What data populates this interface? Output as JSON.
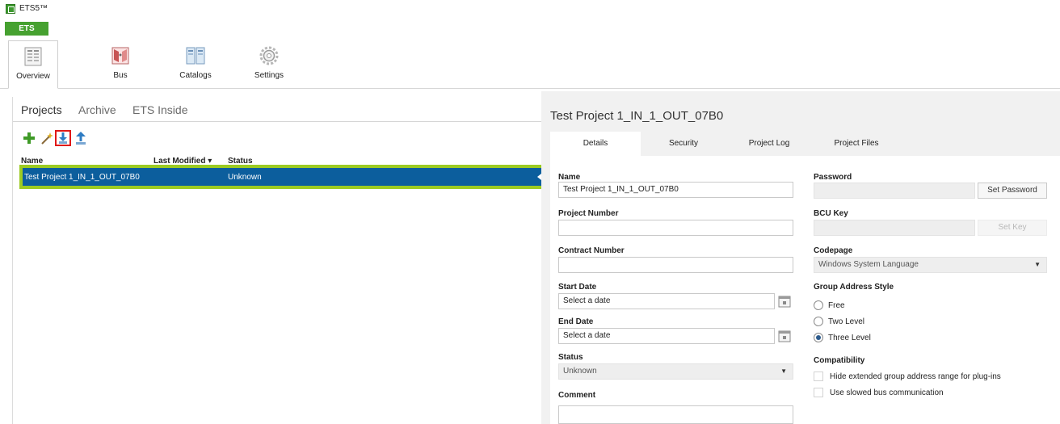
{
  "app": {
    "title": "ETS5™",
    "menu_tab": "ETS"
  },
  "ribbon": [
    {
      "label": "Overview",
      "icon": "overview-icon"
    },
    {
      "label": "Bus",
      "icon": "bus-icon"
    },
    {
      "label": "Catalogs",
      "icon": "catalogs-icon"
    },
    {
      "label": "Settings",
      "icon": "settings-icon"
    }
  ],
  "projects_panel": {
    "tabs": [
      "Projects",
      "Archive",
      "ETS Inside"
    ],
    "toolbar": [
      "add-icon",
      "wizard-icon",
      "import-icon",
      "export-icon"
    ],
    "columns": {
      "name": "Name",
      "last_modified": "Last Modified ▾",
      "status": "Status"
    },
    "rows": [
      {
        "name": "Test Project 1_IN_1_OUT_07B0",
        "last_modified": "",
        "status": "Unknown"
      }
    ]
  },
  "details": {
    "title": "Test Project 1_IN_1_OUT_07B0",
    "tabs": [
      "Details",
      "Security",
      "Project Log",
      "Project Files"
    ],
    "name_label": "Name",
    "name_value": "Test Project 1_IN_1_OUT_07B0",
    "project_number_label": "Project Number",
    "project_number_value": "",
    "contract_number_label": "Contract Number",
    "contract_number_value": "",
    "start_date_label": "Start Date",
    "start_date_placeholder": "Select a date",
    "end_date_label": "End Date",
    "end_date_placeholder": "Select a date",
    "status_label": "Status",
    "status_value": "Unknown",
    "comment_label": "Comment",
    "password_label": "Password",
    "set_password_button": "Set Password",
    "bcu_key_label": "BCU Key",
    "set_key_button": "Set Key",
    "codepage_label": "Codepage",
    "codepage_value": "Windows System Language",
    "group_address_style_label": "Group Address Style",
    "ga_options": [
      "Free",
      "Two Level",
      "Three Level"
    ],
    "ga_selected": "Three Level",
    "compatibility_label": "Compatibility",
    "compat_options": [
      "Hide extended group address range for plug-ins",
      "Use slowed bus communication"
    ]
  },
  "colors": {
    "brand_green": "#46a130",
    "selection_blue": "#0c5e9d",
    "highlight_lime": "#9ccb22",
    "highlight_red": "#e01818"
  }
}
